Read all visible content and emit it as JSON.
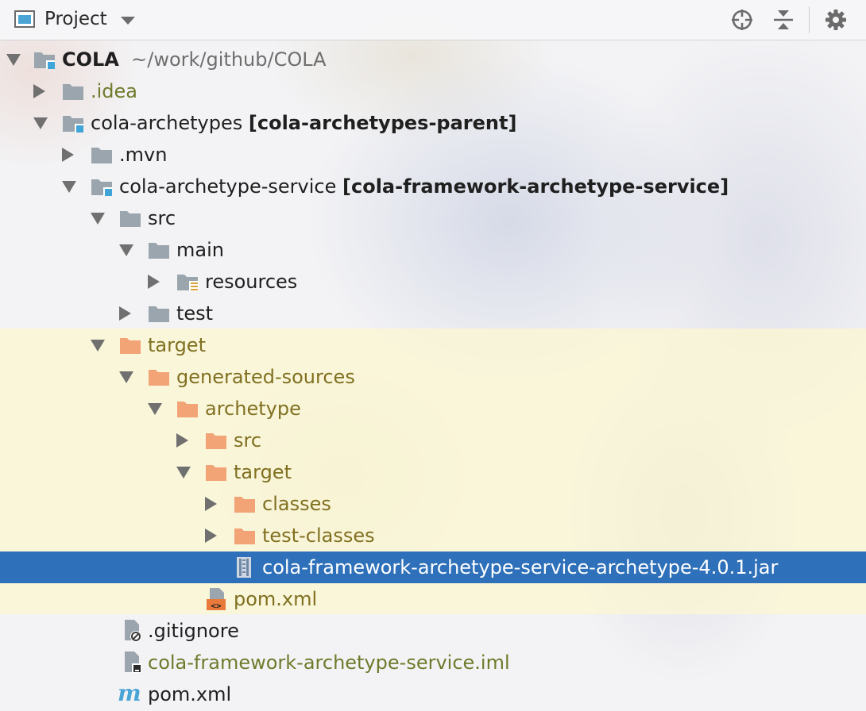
{
  "toolbar": {
    "title": "Project",
    "icons": [
      "project-view-icon",
      "dropdown-caret-icon",
      "locate-icon",
      "collapse-all-icon",
      "settings-gear-icon"
    ]
  },
  "tree": {
    "root": {
      "name": "COLA",
      "path": "~/work/github/COLA"
    },
    "idea": ".idea",
    "archetypes": {
      "name": "cola-archetypes",
      "module": "[cola-archetypes-parent]"
    },
    "mvn": ".mvn",
    "service": {
      "name": "cola-archetype-service",
      "module": "[cola-framework-archetype-service]"
    },
    "src": "src",
    "main": "main",
    "resources": "resources",
    "test": "test",
    "target": "target",
    "generated_sources": "generated-sources",
    "archetype": "archetype",
    "archetype_src": "src",
    "archetype_target": "target",
    "classes": "classes",
    "test_classes": "test-classes",
    "jar": "cola-framework-archetype-service-archetype-4.0.1.jar",
    "archetype_pom": "pom.xml",
    "gitignore": ".gitignore",
    "iml": "cola-framework-archetype-service.iml",
    "pom": "pom.xml"
  },
  "colors": {
    "selection": "#2e70b9",
    "module_badge": "#3fa4d8",
    "excluded_folder": "#f2a477",
    "folder": "#9aa5ae",
    "excluded_text": "#807020"
  }
}
